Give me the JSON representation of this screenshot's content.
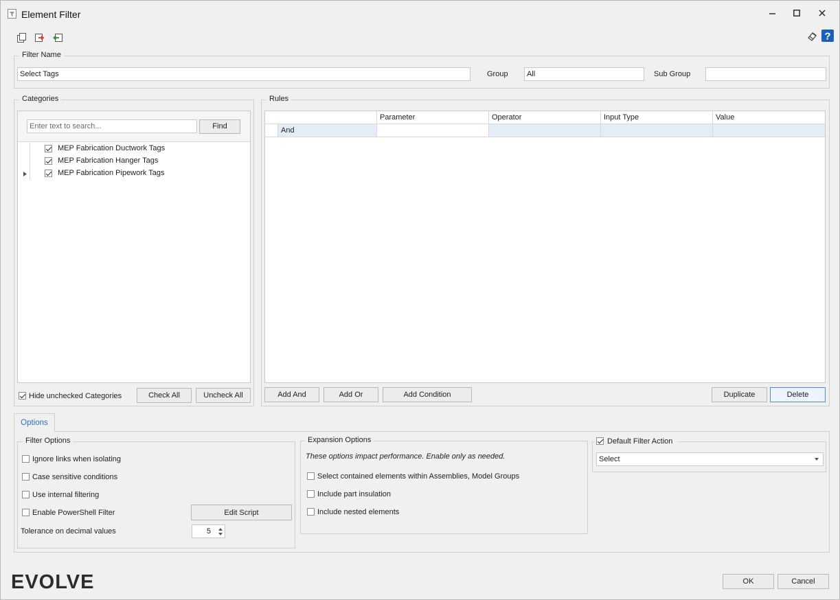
{
  "window": {
    "title": "Element Filter"
  },
  "filter_name": {
    "legend": "Filter Name",
    "value": "Select Tags",
    "group_label": "Group",
    "group_value": "All",
    "subgroup_label": "Sub Group",
    "subgroup_value": ""
  },
  "categories": {
    "legend": "Categories",
    "search_placeholder": "Enter text to search...",
    "find_label": "Find",
    "items": [
      {
        "label": "MEP Fabrication Ductwork Tags",
        "checked": true,
        "expandable": false
      },
      {
        "label": "MEP Fabrication Hanger Tags",
        "checked": true,
        "expandable": false
      },
      {
        "label": "MEP Fabrication Pipework Tags",
        "checked": true,
        "expandable": true
      }
    ],
    "hide_unchecked_label": "Hide unchecked Categories",
    "hide_unchecked_checked": true,
    "check_all_label": "Check All",
    "uncheck_all_label": "Uncheck All"
  },
  "rules": {
    "legend": "Rules",
    "columns": [
      "Parameter",
      "Operator",
      "Input Type",
      "Value"
    ],
    "rows": [
      {
        "logic": "And",
        "parameter": "",
        "operator": "",
        "input_type": "",
        "value": ""
      }
    ],
    "add_and_label": "Add And",
    "add_or_label": "Add Or",
    "add_condition_label": "Add Condition",
    "duplicate_label": "Duplicate",
    "delete_label": "Delete"
  },
  "options": {
    "tab_label": "Options",
    "filter_options": {
      "legend": "Filter Options",
      "items": [
        {
          "label": "Ignore links when isolating",
          "checked": false
        },
        {
          "label": "Case sensitive conditions",
          "checked": false
        },
        {
          "label": "Use internal filtering",
          "checked": false
        },
        {
          "label": "Enable PowerShell Filter",
          "checked": false
        }
      ],
      "edit_script_label": "Edit Script",
      "tolerance_label": "Tolerance on decimal values",
      "tolerance_value": "5"
    },
    "expansion_options": {
      "legend": "Expansion Options",
      "note": "These options impact performance. Enable only as needed.",
      "items": [
        {
          "label": "Select contained elements within Assemblies, Model Groups",
          "checked": false
        },
        {
          "label": "Include part insulation",
          "checked": false
        },
        {
          "label": "Include nested elements",
          "checked": false
        }
      ]
    },
    "default_action": {
      "legend": "Default Filter Action",
      "checked": true,
      "selected": "Select"
    }
  },
  "footer": {
    "logo_text": "EVOLVE",
    "ok_label": "OK",
    "cancel_label": "Cancel"
  },
  "colors": {
    "accent": "#2f6fbf",
    "logo_accent": "#e25b1f",
    "selected_row": "#e3edf8"
  }
}
